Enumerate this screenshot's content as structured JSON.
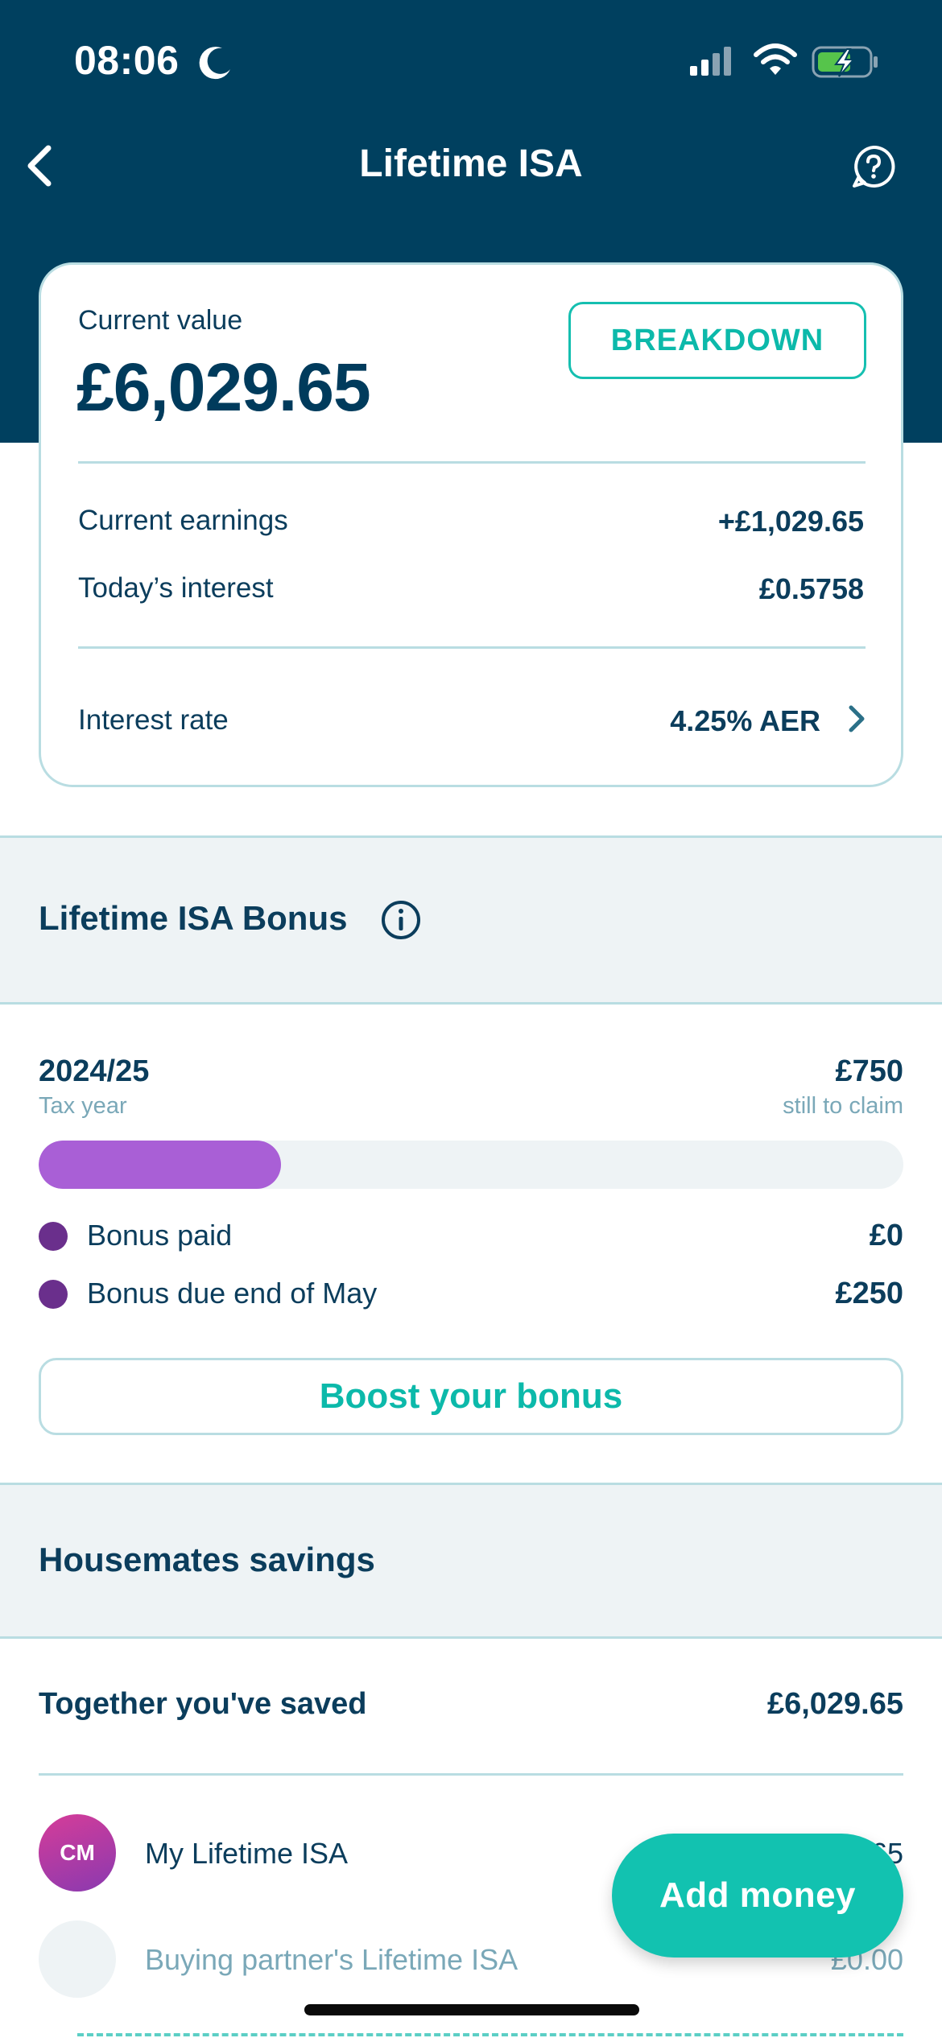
{
  "status_bar": {
    "time": "08:06"
  },
  "nav": {
    "title": "Lifetime ISA"
  },
  "value_card": {
    "current_value_label": "Current value",
    "current_value": "£6,029.65",
    "breakdown_label": "BREAKDOWN",
    "rows": [
      {
        "label": "Current earnings",
        "value": "+£1,029.65"
      },
      {
        "label": "Today’s interest",
        "value": "£0.5758"
      }
    ],
    "interest_rate_label": "Interest rate",
    "interest_rate_value": "4.25% AER"
  },
  "bonus": {
    "title": "Lifetime ISA Bonus",
    "tax_year": "2024/25",
    "tax_year_label": "Tax year",
    "still_to_claim_value": "£750",
    "still_to_claim_label": "still to claim",
    "progress_fraction": 0.28,
    "legend": [
      {
        "label": "Bonus paid",
        "value": "£0"
      },
      {
        "label": "Bonus due end of May",
        "value": "£250"
      }
    ],
    "boost_label": "Boost your bonus"
  },
  "housemates": {
    "title": "Housemates savings",
    "together_label": "Together you've saved",
    "together_value": "£6,029.65",
    "accounts": [
      {
        "initials": "CM",
        "label": "My Lifetime ISA",
        "value": "£6,029.65"
      },
      {
        "initials": "",
        "label": "Buying partner's Lifetime ISA",
        "value": "£0.00"
      }
    ]
  },
  "fab": {
    "label": "Add money"
  },
  "colors": {
    "header": "#00405f",
    "accent": "#12c2b0",
    "progress": "#a95fd6",
    "legend_dot": "#6a2f8c",
    "band": "#eef3f5"
  }
}
